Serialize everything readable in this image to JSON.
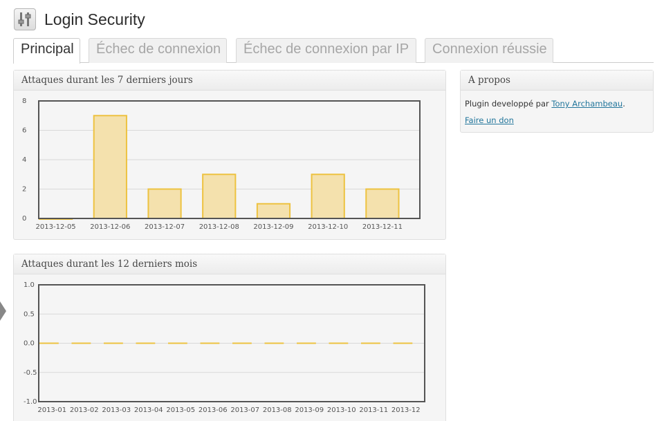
{
  "header": {
    "title": "Login Security",
    "icon": "tools-icon"
  },
  "tabs": [
    {
      "label": "Principal",
      "active": true
    },
    {
      "label": "Échec de connexion",
      "active": false
    },
    {
      "label": "Échec de connexion par IP",
      "active": false
    },
    {
      "label": "Connexion réussie",
      "active": false
    }
  ],
  "weekly_box": {
    "title": "Attaques durant les 7 derniers jours"
  },
  "monthly_box": {
    "title": "Attaques durant les 12 derniers mois"
  },
  "about_box": {
    "title": "A propos",
    "text_prefix": "Plugin developpé par",
    "author_link": "Tony Archambeau",
    "text_suffix": ".",
    "donate_link": "Faire un don"
  },
  "colors": {
    "bar_fill": "#f4e1ad",
    "bar_stroke": "#edc240",
    "plot_border": "#545454",
    "grid": "#d8d8d8"
  },
  "chart_data": [
    {
      "type": "bar",
      "categories": [
        "2013-12-05",
        "2013-12-06",
        "2013-12-07",
        "2013-12-08",
        "2013-12-09",
        "2013-12-10",
        "2013-12-11"
      ],
      "values": [
        0,
        7,
        2,
        3,
        1,
        3,
        2
      ],
      "ylim": [
        0,
        8
      ],
      "yticks": [
        0,
        2,
        4,
        6,
        8
      ],
      "grid": true,
      "title": "Attaques durant les 7 derniers jours"
    },
    {
      "type": "line",
      "categories": [
        "2013-01",
        "2013-02",
        "2013-03",
        "2013-04",
        "2013-05",
        "2013-06",
        "2013-07",
        "2013-08",
        "2013-09",
        "2013-10",
        "2013-11",
        "2013-12"
      ],
      "values": [
        0,
        0,
        0,
        0,
        0,
        0,
        0,
        0,
        0,
        0,
        0,
        0
      ],
      "ylim": [
        -1.0,
        1.0
      ],
      "yticks": [
        "-1.0",
        "-0.5",
        "0.0",
        "0.5",
        "1.0"
      ],
      "grid": true,
      "title": "Attaques durant les 12 derniers mois"
    }
  ]
}
